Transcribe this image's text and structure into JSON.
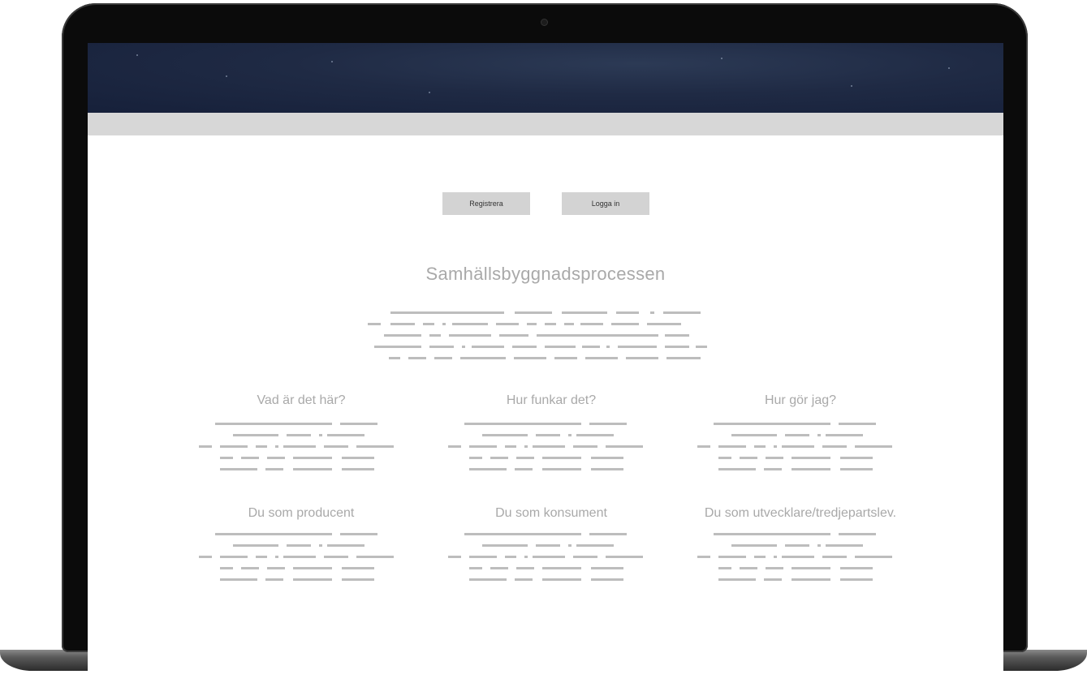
{
  "buttons": {
    "register_label": "Registrera",
    "login_label": "Logga in"
  },
  "main": {
    "title": "Samhällsbyggnadsprocessen"
  },
  "sections": [
    {
      "title": "Vad är det här?"
    },
    {
      "title": "Hur funkar det?"
    },
    {
      "title": "Hur gör jag?"
    },
    {
      "title": "Du som producent"
    },
    {
      "title": "Du som konsument"
    },
    {
      "title": "Du som utvecklare/tredjepartslev."
    }
  ],
  "colors": {
    "hero": "#1f2a44",
    "nav_strip": "#d7d7d7",
    "button": "#d3d3d3",
    "placeholder_text": "#bdbdbd",
    "heading": "#a9a9a9"
  }
}
